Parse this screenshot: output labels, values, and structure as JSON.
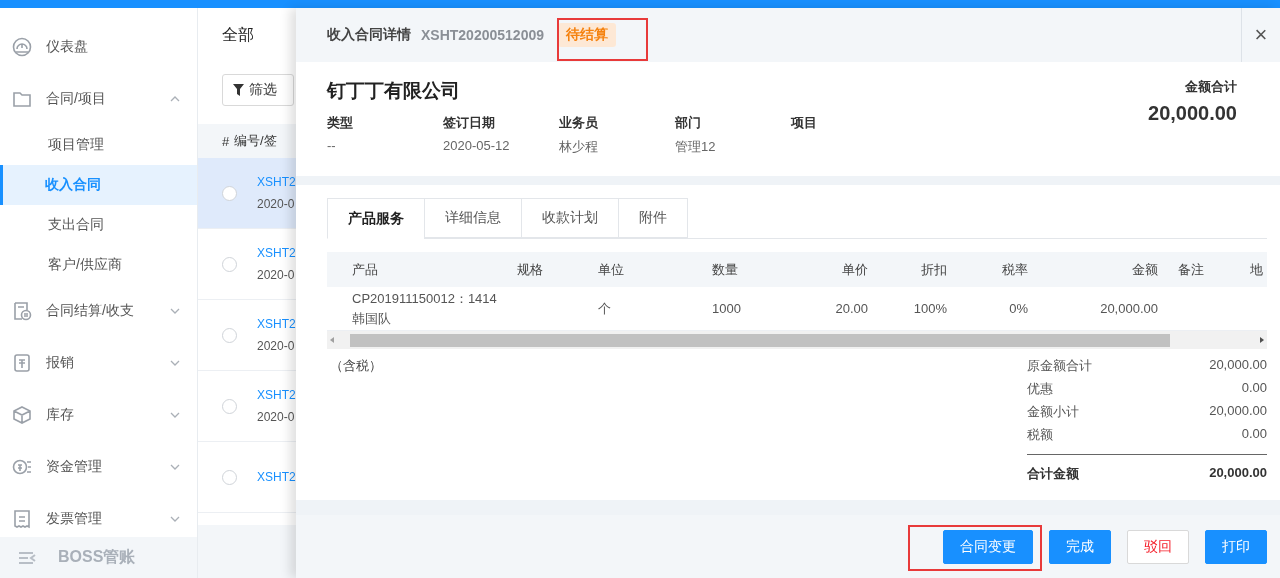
{
  "sidebar": {
    "items": [
      {
        "label": "仪表盘",
        "kind": "link",
        "selected": false
      },
      {
        "label": "合同/项目",
        "kind": "group",
        "selected": false,
        "expanded": true,
        "children": [
          {
            "label": "项目管理",
            "selected": false
          },
          {
            "label": "收入合同",
            "selected": true
          },
          {
            "label": "支出合同",
            "selected": false
          },
          {
            "label": "客户/供应商",
            "selected": false
          }
        ]
      },
      {
        "label": "合同结算/收支",
        "kind": "group",
        "selected": false,
        "expanded": false
      },
      {
        "label": "报销",
        "kind": "group",
        "selected": false,
        "expanded": false
      },
      {
        "label": "库存",
        "kind": "group",
        "selected": false,
        "expanded": false
      },
      {
        "label": "资金管理",
        "kind": "group",
        "selected": false,
        "expanded": false
      },
      {
        "label": "发票管理",
        "kind": "group",
        "selected": false,
        "expanded": false
      }
    ],
    "footer": "BOSS管账"
  },
  "list": {
    "tabs": [
      {
        "label": "全部"
      }
    ],
    "filter_button": "筛选",
    "columns": [
      "#",
      "编号/签"
    ],
    "rows": [
      {
        "number": "XSHT2",
        "date": "2020-0",
        "selected": true
      },
      {
        "number": "XSHT2",
        "date": "2020-0",
        "selected": false
      },
      {
        "number": "XSHT2",
        "date": "2020-0",
        "selected": false
      },
      {
        "number": "XSHT2",
        "date": "2020-0",
        "selected": false
      },
      {
        "number": "XSHT2",
        "selected": false
      }
    ]
  },
  "drawer": {
    "title": "收入合同详情",
    "code": "XSHT20200512009",
    "status": "待结算",
    "close": "×",
    "company": "钉丁丁有限公司",
    "fields": [
      {
        "label": "类型",
        "value": "--"
      },
      {
        "label": "签订日期",
        "value": "2020-05-12"
      },
      {
        "label": "业务员",
        "value": "林少程"
      },
      {
        "label": "部门",
        "value": "管理12"
      },
      {
        "label": "项目"
      }
    ],
    "total_label": "金额合计",
    "total": "20,000.00",
    "tabs": [
      {
        "label": "产品服务",
        "selected": true
      },
      {
        "label": "详细信息",
        "selected": false
      },
      {
        "label": "收款计划",
        "selected": false
      },
      {
        "label": "附件",
        "selected": false
      }
    ],
    "table": {
      "columns": [
        "产品",
        "规格",
        "单位",
        "数量",
        "单价",
        "折扣",
        "税率",
        "金额",
        "备注",
        "地"
      ],
      "rows": [
        {
          "product": "CP201911150012：1414",
          "product_name": "韩国队",
          "unit": "个",
          "quantity": "1000",
          "price": "20.00",
          "discount": "100%",
          "tax_rate": "0%",
          "amount": "20,000.00"
        }
      ]
    },
    "tax_note": "（含税）",
    "summary": [
      {
        "label": "原金额合计",
        "value": "20,000.00"
      },
      {
        "label": "优惠",
        "value": "0.00"
      },
      {
        "label": "金额小计",
        "value": "20,000.00"
      },
      {
        "label": "税额",
        "value": "0.00"
      }
    ],
    "grand_total": {
      "label": "合计金额",
      "value": "20,000.00"
    },
    "buttons": [
      {
        "label": "合同变更",
        "kind": "primary"
      },
      {
        "label": "完成",
        "kind": "primary"
      },
      {
        "label": "驳回",
        "kind": "danger"
      },
      {
        "label": "打印",
        "kind": "primary"
      }
    ]
  }
}
